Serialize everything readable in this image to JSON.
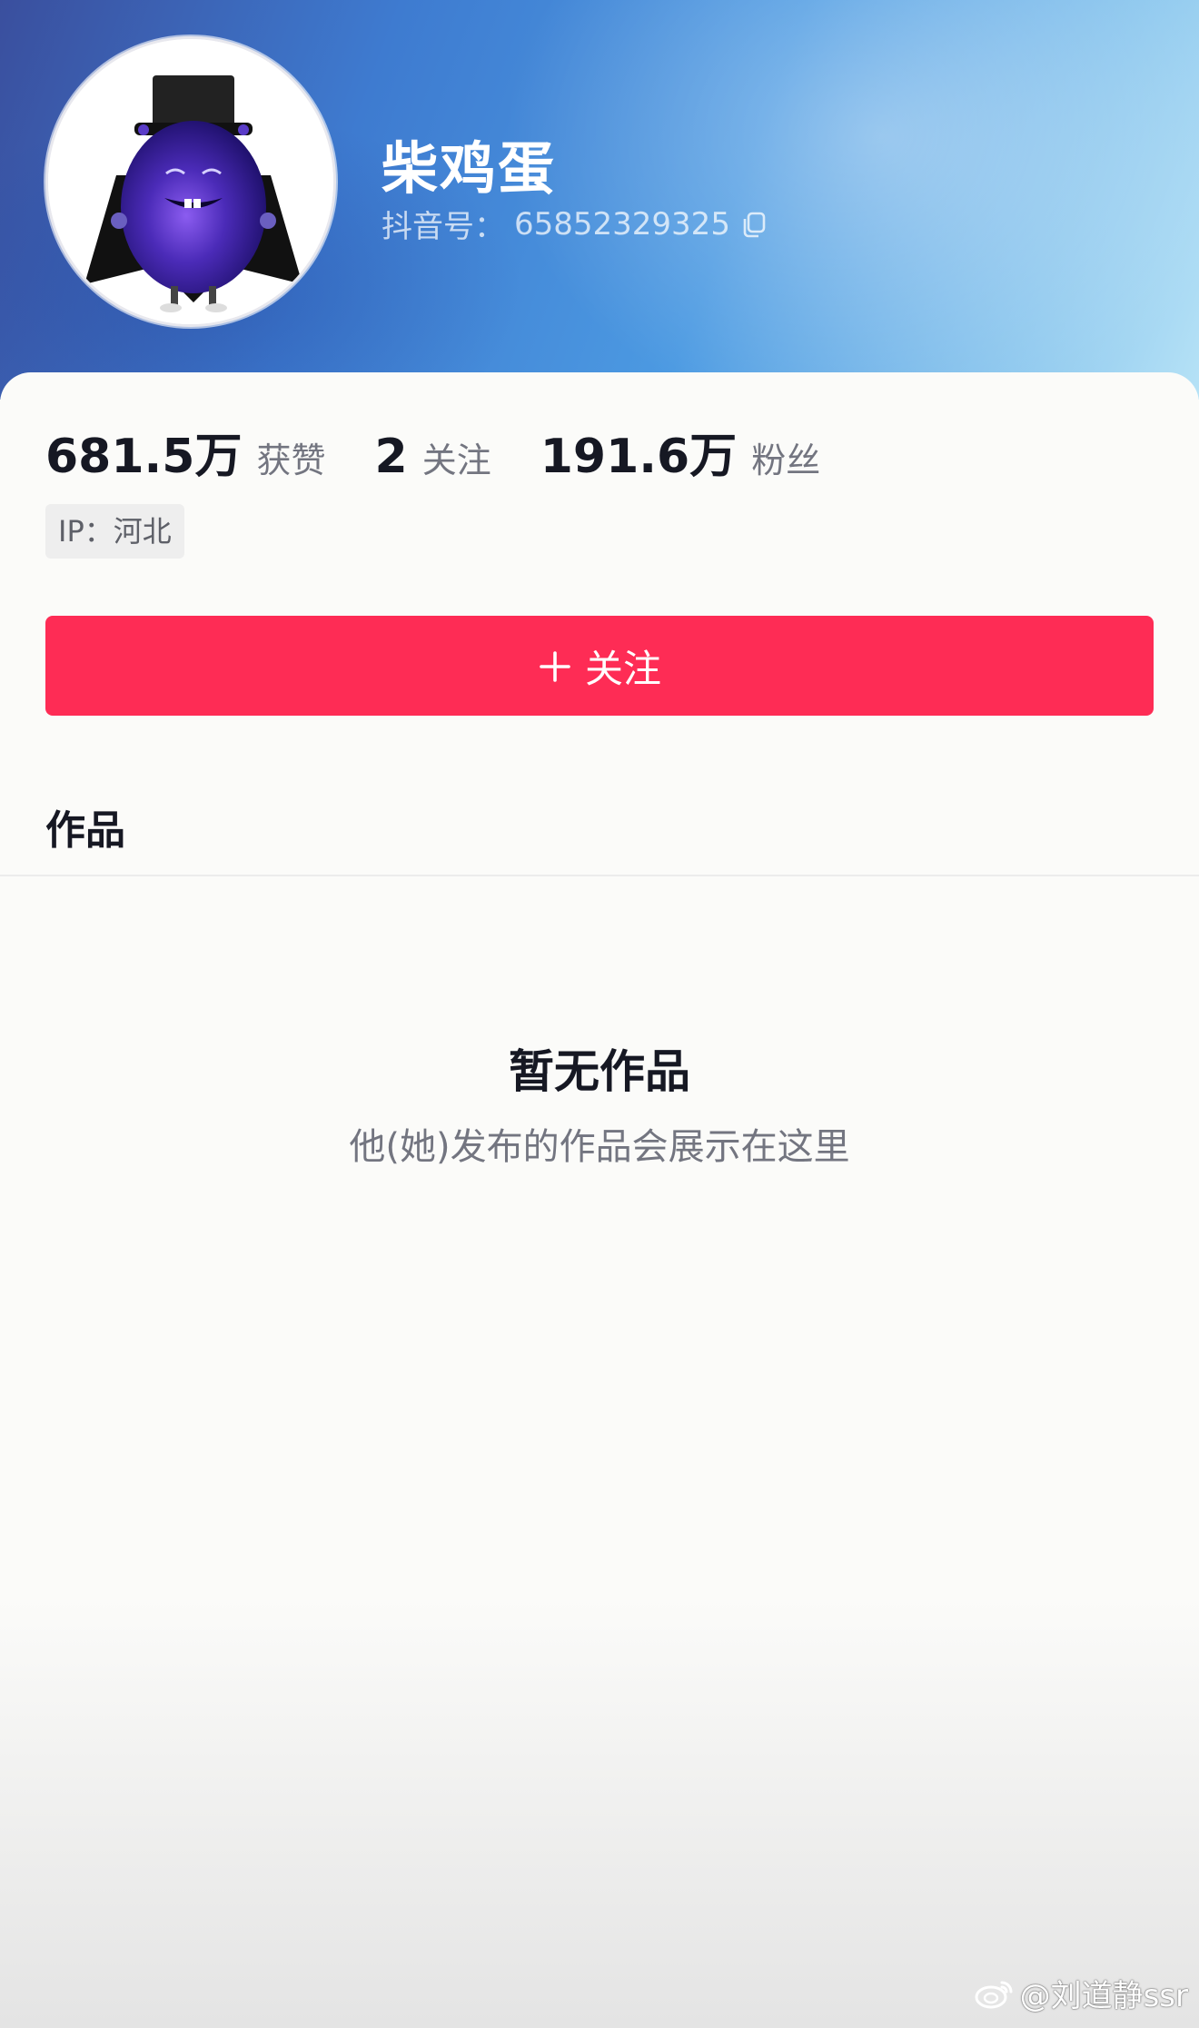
{
  "profile": {
    "nickname": "柴鸡蛋",
    "douyin_id_label": "抖音号：",
    "douyin_id": "65852329325"
  },
  "stats": {
    "likes": {
      "value": "681.5万",
      "label": "获赞"
    },
    "following": {
      "value": "2",
      "label": "关注"
    },
    "followers": {
      "value": "191.6万",
      "label": "粉丝"
    }
  },
  "ip": {
    "text": "IP：河北"
  },
  "follow_button": {
    "label": "关注"
  },
  "tabs": {
    "works": "作品"
  },
  "empty_state": {
    "title": "暂无作品",
    "subtitle": "他(她)发布的作品会展示在这里"
  },
  "watermark": {
    "text": "@刘道静ssr"
  },
  "colors": {
    "accent": "#fe2c55",
    "text_primary": "#161823",
    "text_secondary": "#737580"
  },
  "icons": [
    "copy-icon",
    "plus-icon",
    "weibo-icon",
    "avatar-eggplant-character"
  ]
}
